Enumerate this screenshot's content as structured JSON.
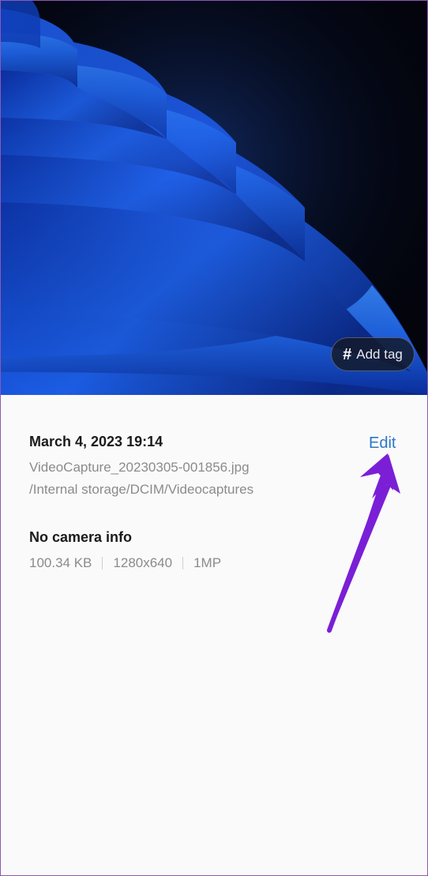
{
  "photo": {
    "add_tag_label": "Add tag",
    "add_tag_symbol": "#",
    "background_color": "#03040c",
    "accent_color": "#1c5fe8"
  },
  "details": {
    "date_time": "March 4, 2023 19:14",
    "edit_label": "Edit",
    "file_name": "VideoCapture_20230305-001856.jpg",
    "file_path": "/Internal storage/DCIM/Videocaptures",
    "camera_info": "No camera info",
    "file_size": "100.34 KB",
    "resolution": "1280x640",
    "megapixels": "1MP"
  },
  "annotation": {
    "arrow_color": "#7a1fd6"
  }
}
